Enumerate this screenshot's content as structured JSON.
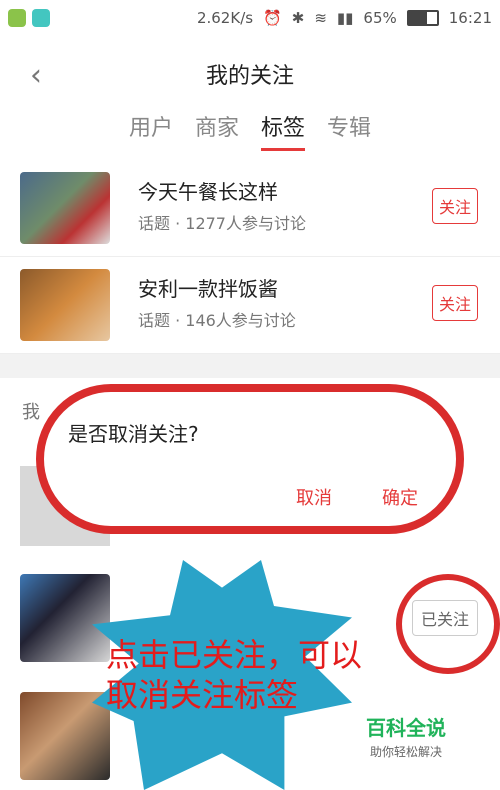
{
  "status_bar": {
    "network_speed": "2.62K/s",
    "battery": "65%",
    "time": "16:21"
  },
  "header": {
    "title": "我的关注",
    "tabs": [
      "用户",
      "商家",
      "标签",
      "专辑"
    ],
    "active_tab": "标签"
  },
  "topics": [
    {
      "title": "今天午餐长这样",
      "meta": "话题 · 1277人参与讨论",
      "button": "关注"
    },
    {
      "title": "安利一款拌饭酱",
      "meta": "话题 · 146人参与讨论",
      "button": "关注"
    }
  ],
  "section": {
    "label": "我"
  },
  "followed_button": "已关注",
  "dialog": {
    "question": "是否取消关注?",
    "cancel": "取消",
    "confirm": "确定"
  },
  "annotation": "点击已关注，可以取消关注标签",
  "watermark": {
    "title": "百科全说",
    "subtitle": "助你轻松解决"
  }
}
